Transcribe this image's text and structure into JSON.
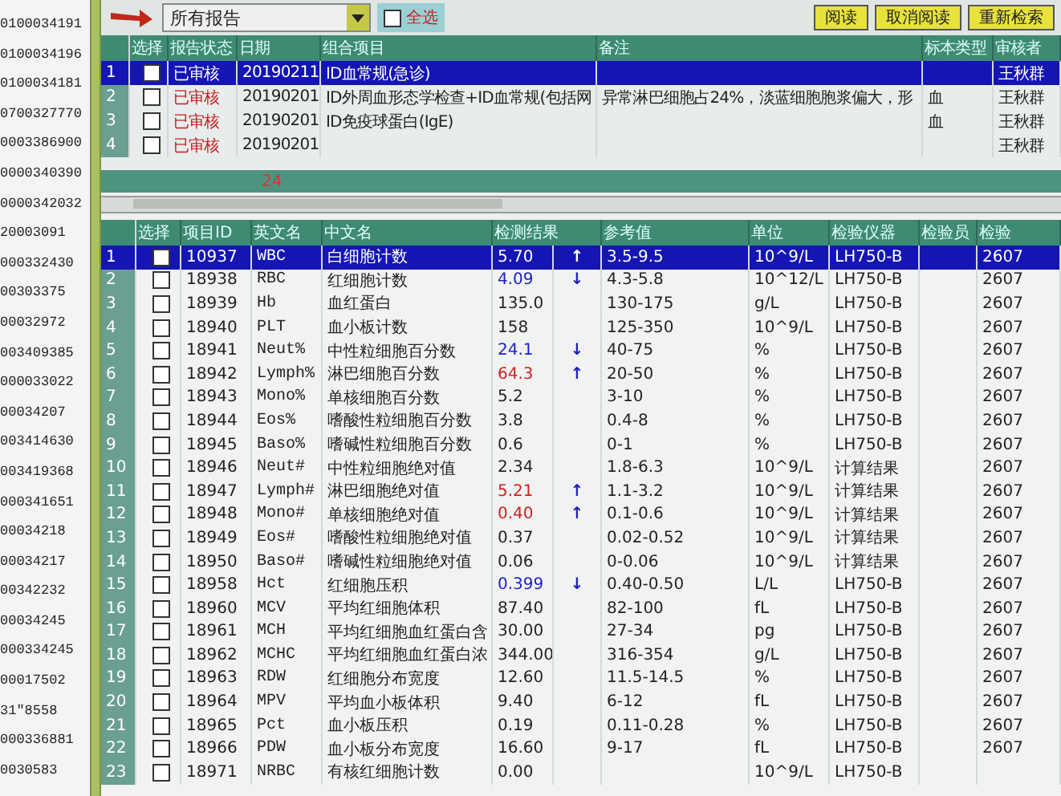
{
  "toolbar": {
    "report_filter": "所有报告",
    "select_all": {
      "label": "全选",
      "checked": false
    },
    "buttons": [
      "阅读",
      "取消阅读",
      "重新检索"
    ]
  },
  "id_list": [
    "0100034191",
    "0100034196",
    "0100034181",
    "0700327770",
    "0003386900",
    "0000340390",
    "0000342032",
    "20003091",
    "000332430",
    "00303375",
    "00032972",
    "003409385",
    "000033022",
    "00034207",
    "003414630",
    "003419368",
    "000341651",
    "00034218",
    "00034217",
    "00342232",
    "00034245",
    "000334245",
    "00017502",
    "31\"8558",
    "000336881",
    "0030583"
  ],
  "report_table": {
    "columns": [
      "选择",
      "报告状态",
      "日期",
      "组合项目",
      "备注",
      "标本类型",
      "审核者"
    ],
    "rows": [
      {
        "number": "1",
        "selected": true,
        "checked": false,
        "status": "已审核",
        "date": "20190211",
        "item": "ID血常规(急诊)",
        "reviewer": "王秋群"
      },
      {
        "number": "2",
        "selected": false,
        "checked": false,
        "status": "已审核",
        "date": "20190201",
        "item": "ID外周血形态学检查+ID血常规(包括网",
        "remark": "异常淋巴细胞占24%，淡蓝细胞胞浆偏大，形",
        "specimen": "血",
        "reviewer": "王秋群"
      },
      {
        "number": "3",
        "selected": false,
        "checked": false,
        "status": "已审核",
        "date": "20190201",
        "item": "ID免疫球蛋白(IgE)",
        "specimen": "血",
        "reviewer": "王秋群"
      },
      {
        "number": "4",
        "selected": false,
        "checked": false,
        "status": "已审核",
        "date": "20190201",
        "reviewer": "王秋群"
      }
    ],
    "footer": "24"
  },
  "result_table": {
    "columns": [
      "选择",
      "项目ID",
      "英文名",
      "中文名",
      "检测结果",
      "参考值",
      "单位",
      "检验仪器",
      "检验员",
      "检验"
    ],
    "rows": [
      {
        "number": "1",
        "selected": true,
        "checked": false,
        "id": "10937",
        "en": "WBC",
        "cn": "白细胞计数",
        "result": "5.70",
        "arrow": "↑",
        "range": "3.5-9.5",
        "unit": "10^9/L",
        "instrument": "LH750-B",
        "code": "2607"
      },
      {
        "number": "2",
        "selected": false,
        "checked": false,
        "id": "18938",
        "en": "RBC",
        "cn": "红细胞计数",
        "result": "4.09",
        "color": "#2020c0",
        "arrow": "↓",
        "range": "4.3-5.8",
        "unit": "10^12/L",
        "instrument": "LH750-B",
        "code": "2607"
      },
      {
        "number": "3",
        "selected": false,
        "checked": false,
        "id": "18939",
        "en": "Hb",
        "cn": "血红蛋白",
        "result": "135.0",
        "range": "130-175",
        "unit": "g/L",
        "instrument": "LH750-B",
        "code": "2607"
      },
      {
        "number": "4",
        "selected": false,
        "checked": false,
        "id": "18940",
        "en": "PLT",
        "cn": "血小板计数",
        "result": "158",
        "range": "125-350",
        "unit": "10^9/L",
        "instrument": "LH750-B",
        "code": "2607"
      },
      {
        "number": "5",
        "selected": false,
        "checked": false,
        "id": "18941",
        "en": "Neut%",
        "cn": "中性粒细胞百分数",
        "result": "24.1",
        "color": "#2020c0",
        "arrow": "↓",
        "range": "40-75",
        "unit": "%",
        "instrument": "LH750-B",
        "code": "2607"
      },
      {
        "number": "6",
        "selected": false,
        "checked": false,
        "id": "18942",
        "en": "Lymph%",
        "cn": "淋巴细胞百分数",
        "result": "64.3",
        "color": "#d02020",
        "arrow": "↑",
        "range": "20-50",
        "unit": "%",
        "instrument": "LH750-B",
        "code": "2607"
      },
      {
        "number": "7",
        "selected": false,
        "checked": false,
        "id": "18943",
        "en": "Mono%",
        "cn": "单核细胞百分数",
        "result": "5.2",
        "range": "3-10",
        "unit": "%",
        "instrument": "LH750-B",
        "code": "2607"
      },
      {
        "number": "8",
        "selected": false,
        "checked": false,
        "id": "18944",
        "en": "Eos%",
        "cn": "嗜酸性粒细胞百分数",
        "result": "3.8",
        "range": "0.4-8",
        "unit": "%",
        "instrument": "LH750-B",
        "code": "2607"
      },
      {
        "number": "9",
        "selected": false,
        "checked": false,
        "id": "18945",
        "en": "Baso%",
        "cn": "嗜碱性粒细胞百分数",
        "result": "0.6",
        "range": "0-1",
        "unit": "%",
        "instrument": "LH750-B",
        "code": "2607"
      },
      {
        "number": "10",
        "selected": false,
        "checked": false,
        "id": "18946",
        "en": "Neut#",
        "cn": "中性粒细胞绝对值",
        "result": "2.34",
        "range": "1.8-6.3",
        "unit": "10^9/L",
        "instrument": "计算结果",
        "code": "2607"
      },
      {
        "number": "11",
        "selected": false,
        "checked": false,
        "id": "18947",
        "en": "Lymph#",
        "cn": "淋巴细胞绝对值",
        "result": "5.21",
        "color": "#d02020",
        "arrow": "↑",
        "range": "1.1-3.2",
        "unit": "10^9/L",
        "instrument": "计算结果",
        "code": "2607"
      },
      {
        "number": "12",
        "selected": false,
        "checked": false,
        "id": "18948",
        "en": "Mono#",
        "cn": "单核细胞绝对值",
        "result": "0.40",
        "color": "#d02020",
        "arrow": "↑",
        "range": "0.1-0.6",
        "unit": "10^9/L",
        "instrument": "计算结果",
        "code": "2607"
      },
      {
        "number": "13",
        "selected": false,
        "checked": false,
        "id": "18949",
        "en": "Eos#",
        "cn": "嗜酸性粒细胞绝对值",
        "result": "0.37",
        "range": "0.02-0.52",
        "unit": "10^9/L",
        "instrument": "计算结果",
        "code": "2607"
      },
      {
        "number": "14",
        "selected": false,
        "checked": false,
        "id": "18950",
        "en": "Baso#",
        "cn": "嗜碱性粒细胞绝对值",
        "result": "0.06",
        "range": "0-0.06",
        "unit": "10^9/L",
        "instrument": "计算结果",
        "code": "2607"
      },
      {
        "number": "15",
        "selected": false,
        "checked": false,
        "id": "18958",
        "en": "Hct",
        "cn": "红细胞压积",
        "result": "0.399",
        "color": "#2020c0",
        "arrow": "↓",
        "range": "0.40-0.50",
        "unit": "L/L",
        "instrument": "LH750-B",
        "code": "2607"
      },
      {
        "number": "16",
        "selected": false,
        "checked": false,
        "id": "18960",
        "en": "MCV",
        "cn": "平均红细胞体积",
        "result": "87.40",
        "range": "82-100",
        "unit": "fL",
        "instrument": "LH750-B",
        "code": "2607"
      },
      {
        "number": "17",
        "selected": false,
        "checked": false,
        "id": "18961",
        "en": "MCH",
        "cn": "平均红细胞血红蛋白含",
        "result": "30.00",
        "range": "27-34",
        "unit": "pg",
        "instrument": "LH750-B",
        "code": "2607"
      },
      {
        "number": "18",
        "selected": false,
        "checked": false,
        "id": "18962",
        "en": "MCHC",
        "cn": "平均红细胞血红蛋白浓",
        "result": "344.00",
        "range": "316-354",
        "unit": "g/L",
        "instrument": "LH750-B",
        "code": "2607"
      },
      {
        "number": "19",
        "selected": false,
        "checked": false,
        "id": "18963",
        "en": "RDW",
        "cn": "红细胞分布宽度",
        "result": "12.60",
        "range": "11.5-14.5",
        "unit": "%",
        "instrument": "LH750-B",
        "code": "2607"
      },
      {
        "number": "20",
        "selected": false,
        "checked": false,
        "id": "18964",
        "en": "MPV",
        "cn": "平均血小板体积",
        "result": "9.40",
        "range": "6-12",
        "unit": "fL",
        "instrument": "LH750-B",
        "code": "2607"
      },
      {
        "number": "21",
        "selected": false,
        "checked": false,
        "id": "18965",
        "en": "Pct",
        "cn": "血小板压积",
        "result": "0.19",
        "range": "0.11-0.28",
        "unit": "%",
        "instrument": "LH750-B",
        "code": "2607"
      },
      {
        "number": "22",
        "selected": false,
        "checked": false,
        "id": "18966",
        "en": "PDW",
        "cn": "血小板分布宽度",
        "result": "16.60",
        "range": "9-17",
        "unit": "fL",
        "instrument": "LH750-B",
        "code": "2607"
      },
      {
        "number": "23",
        "selected": false,
        "checked": false,
        "id": "18971",
        "en": "NRBC",
        "cn": "有核红细胞计数",
        "result": "0.00",
        "unit": "10^9/L",
        "instrument": "LH750-B"
      }
    ]
  }
}
